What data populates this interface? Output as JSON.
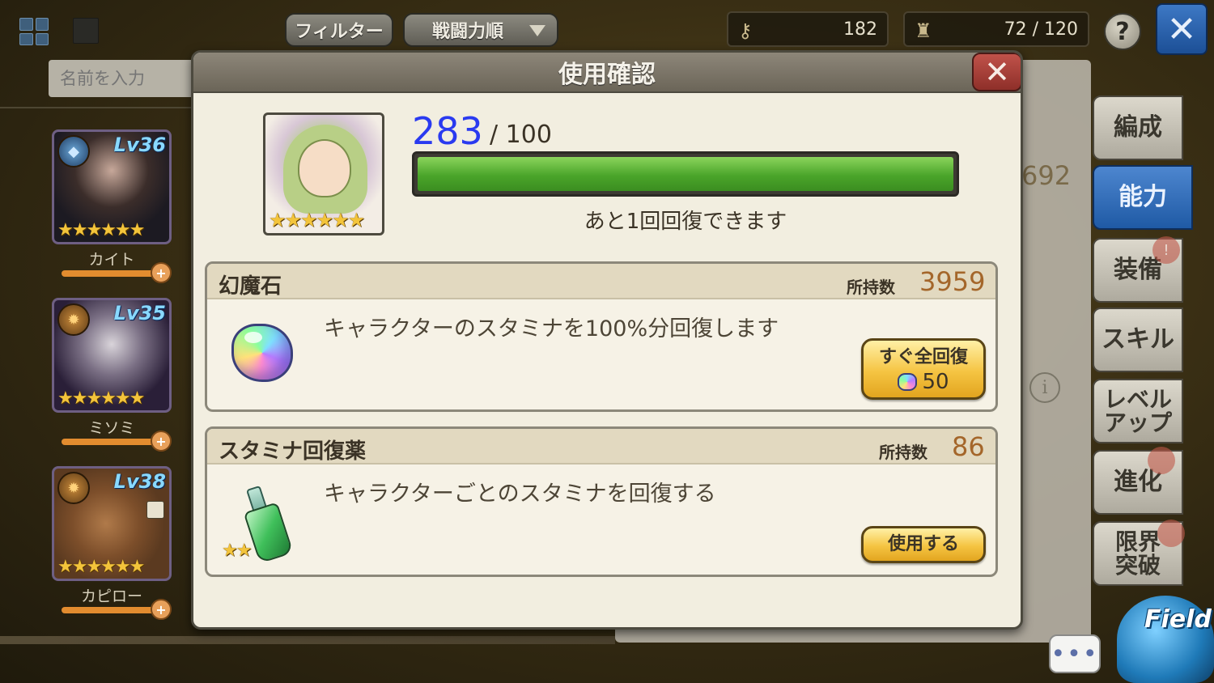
{
  "topbar": {
    "filter_label": "フィルター",
    "sort_label": "戦闘力順",
    "stat1_value": "182",
    "stat2_value": "72 / 120",
    "help_label": "?",
    "close_label": "✕"
  },
  "search": {
    "placeholder": "名前を入力"
  },
  "characters": [
    {
      "name": "カイト",
      "level": "Lv36",
      "stars": "★★★★★★"
    },
    {
      "name": "ミソミ",
      "level": "Lv35",
      "stars": "★★★★★★"
    },
    {
      "name": "カピロー",
      "level": "Lv38",
      "stars": "★★★★★★"
    }
  ],
  "background": {
    "number": "692"
  },
  "side_tabs": [
    {
      "label": "編成"
    },
    {
      "label": "能力"
    },
    {
      "label": "装備"
    },
    {
      "label": "スキル"
    },
    {
      "label": "レベル\nアップ"
    },
    {
      "label": "進化"
    },
    {
      "label": "限界\n突破"
    }
  ],
  "field_label": "Field",
  "chat_label": "•••",
  "modal": {
    "title": "使用確認",
    "close_label": "✕",
    "stamina": {
      "current": "283",
      "max": "/ 100",
      "fill_fraction": 1.0
    },
    "note": "あと1回回復できます",
    "hero_stars": "★★★★★★",
    "items": [
      {
        "name": "幻魔石",
        "owned_label": "所持数",
        "owned_value": "3959",
        "description": "キャラクターのスタミナを100%分回復します",
        "button_label": "すぐ全回復",
        "button_cost": "50"
      },
      {
        "name": "スタミナ回復薬",
        "owned_label": "所持数",
        "owned_value": "86",
        "description": "キャラクターごとのスタミナを回復する",
        "button_label": "使用する",
        "stars": "★★"
      }
    ]
  },
  "colors": {
    "stamina_value": "#2a3af0",
    "owned_value": "#a4662a",
    "active_tab": "#1f5aa5",
    "stamina_fill": "#4aa52a"
  }
}
